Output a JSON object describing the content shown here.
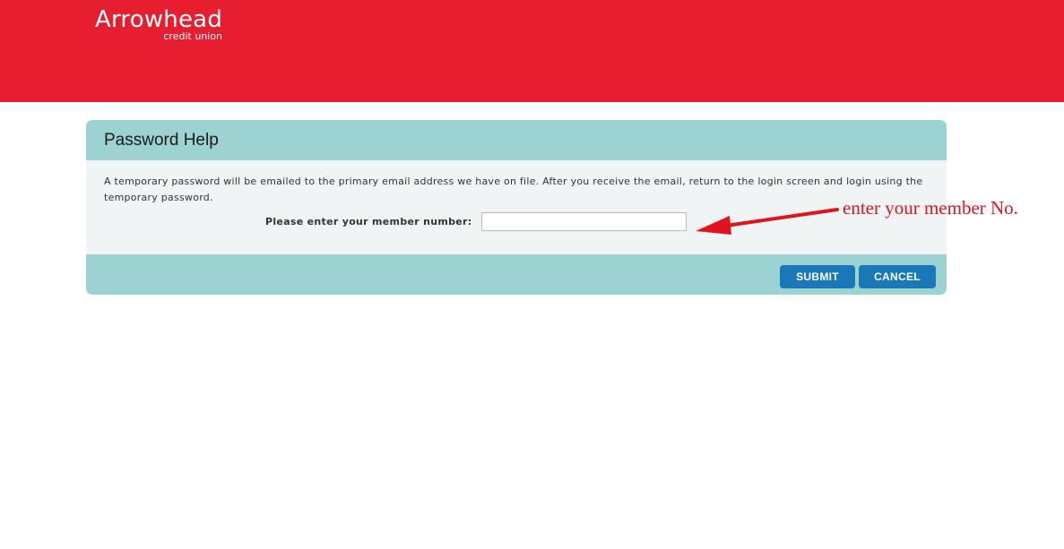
{
  "brand": {
    "name": "Arrowhead",
    "subtitle": "credit union",
    "color": "#e71e30"
  },
  "panel": {
    "title": "Password Help",
    "info": "A temporary password will be emailed to the primary email address we have on file. After you receive the email, return to the login screen and login using the temporary password.",
    "member_label": "Please enter your member number:",
    "member_value": "",
    "member_placeholder": "",
    "header_color": "#9dd2d2"
  },
  "buttons": {
    "submit": "SUBMIT",
    "cancel": "CANCEL",
    "color": "#1a77b8"
  },
  "annotation": {
    "text": "enter your member No.",
    "color": "#e0141e",
    "icon": "red-arrow-icon"
  }
}
